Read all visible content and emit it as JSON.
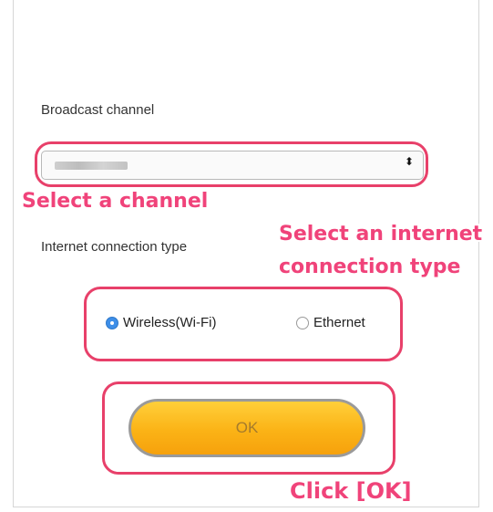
{
  "form": {
    "broadcast_label": "Broadcast channel",
    "connection_label": "Internet connection type",
    "select_arrow": "⬍",
    "radio_options": [
      {
        "label": "Wireless(Wi-Fi)",
        "checked": true
      },
      {
        "label": "Ethernet",
        "checked": false
      }
    ],
    "ok_label": "OK"
  },
  "annotations": {
    "select_channel": "Select a channel",
    "select_connection_line1": "Select an internet",
    "select_connection_line2": "connection type",
    "click_ok": "Click [OK]"
  },
  "colors": {
    "highlight": "#e8406a",
    "annotation_text": "#f0437a",
    "button_orange": "#fbb316",
    "radio_selected": "#3d8ee8"
  }
}
